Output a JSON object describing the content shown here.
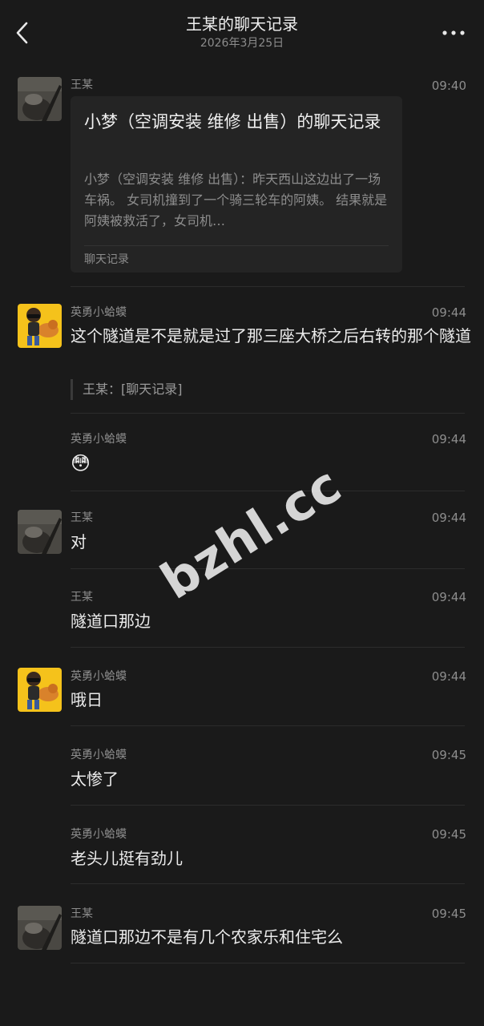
{
  "header": {
    "title": "王某的聊天记录",
    "date": "2026年3月25日",
    "back_icon": "chevron-left-icon",
    "more_icon": "more-dots-icon"
  },
  "messages": [
    {
      "sender": "王某",
      "time": "09:40",
      "avatar": "dark-photo",
      "card": {
        "title": "小梦（空调安装 维修 出售）的聊天记录",
        "desc": "小梦（空调安装 维修 出售）：昨天西山这边出了一场车祸。 女司机撞到了一个骑三轮车的阿姨。 结果就是阿姨被救活了，女司机…",
        "footer": "聊天记录"
      }
    },
    {
      "sender": "英勇小蛤蟆",
      "time": "09:44",
      "avatar": "cartoon",
      "text": "这个隧道是不是就是过了那三座大桥之后右转的那个隧道",
      "quote": "王某：[聊天记录]"
    },
    {
      "sender": "英勇小蛤蟆",
      "time": "09:44",
      "emoji": "😳"
    },
    {
      "sender": "王某",
      "time": "09:44",
      "avatar": "dark-photo",
      "text": "对"
    },
    {
      "sender": "王某",
      "time": "09:44",
      "text": "隧道口那边"
    },
    {
      "sender": "英勇小蛤蟆",
      "time": "09:44",
      "avatar": "cartoon",
      "text": "哦日"
    },
    {
      "sender": "英勇小蛤蟆",
      "time": "09:45",
      "text": "太惨了"
    },
    {
      "sender": "英勇小蛤蟆",
      "time": "09:45",
      "text": "老头儿挺有劲儿"
    },
    {
      "sender": "王某",
      "time": "09:45",
      "avatar": "dark-photo",
      "text": "隧道口那边不是有几个农家乐和住宅么"
    }
  ],
  "watermark": "bzhl.cc",
  "colors": {
    "background": "#1a1a1a",
    "card": "#242424",
    "muted": "#8d8d8d"
  }
}
